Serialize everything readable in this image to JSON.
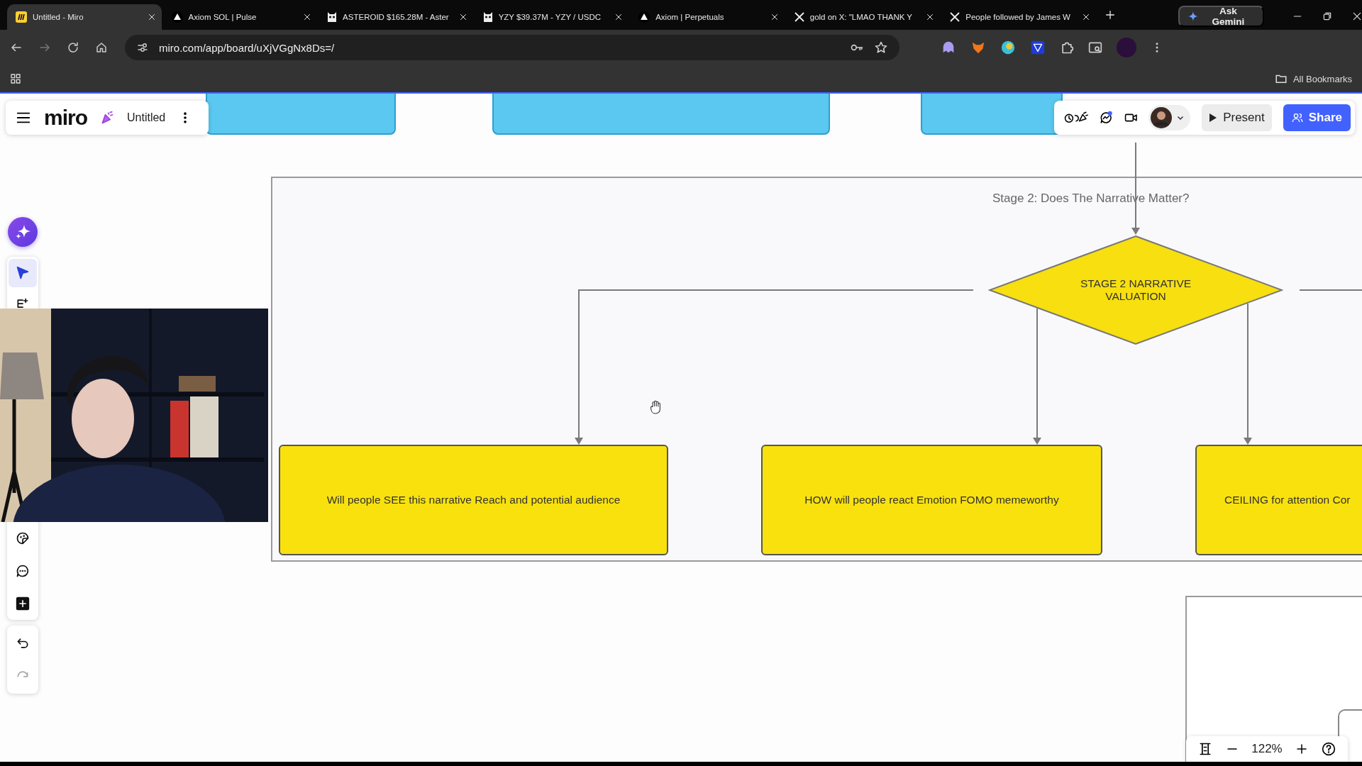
{
  "browser": {
    "tabs": [
      {
        "title": "Untitled - Miro",
        "kind": "miro",
        "selected": true
      },
      {
        "title": "Axiom SOL | Pulse",
        "kind": "axiom",
        "selected": false
      },
      {
        "title": "ASTEROID $165.28M - Aster",
        "kind": "owl",
        "selected": false
      },
      {
        "title": "YZY $39.37M - YZY / USDC",
        "kind": "owl",
        "selected": false
      },
      {
        "title": "Axiom | Perpetuals",
        "kind": "axiom",
        "selected": false
      },
      {
        "title": "gold on X: \"LMAO THANK Y",
        "kind": "x",
        "selected": false
      },
      {
        "title": "People followed by James W",
        "kind": "x",
        "selected": false
      }
    ],
    "ask_gemini": "Ask Gemini",
    "address": "miro.com/app/board/uXjVGgNx8Ds=/",
    "bookmarks": "All Bookmarks"
  },
  "board": {
    "logo": "miro",
    "title": "Untitled",
    "present": "Present",
    "share": "Share",
    "zoom": "122%"
  },
  "toolbar": {
    "top": [
      {
        "kind": "select",
        "selected": true
      },
      {
        "kind": "list",
        "selected": false
      }
    ],
    "bottom": [
      {
        "kind": "sticker"
      },
      {
        "kind": "comment"
      },
      {
        "kind": "add"
      }
    ],
    "history": [
      {
        "kind": "undo",
        "disabled": false
      },
      {
        "kind": "redo",
        "disabled": true
      }
    ]
  },
  "frame": {
    "title": "Stage 2: Does The Narrative Matter?",
    "decision": "STAGE 2 NARRATIVE VALUATION",
    "nodes": [
      "Will people SEE this narrative Reach and potential audience",
      "HOW will people react Emotion FOMO memeworthy",
      "CEILING for attention Cor"
    ]
  }
}
